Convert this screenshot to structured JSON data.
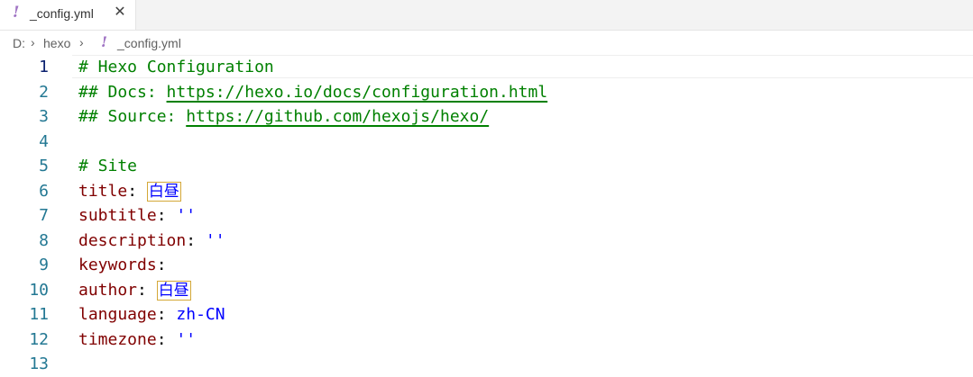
{
  "tab": {
    "icon": "!",
    "label": "_config.yml",
    "close": "✕"
  },
  "breadcrumbs": {
    "drive": "D:",
    "folder": "hexo",
    "icon": "!",
    "file": "_config.yml",
    "sep": "›"
  },
  "lines": [
    {
      "num": "1",
      "parts": [
        {
          "t": "# Hexo Configuration",
          "c": "comment"
        }
      ]
    },
    {
      "num": "2",
      "parts": [
        {
          "t": "## Docs: ",
          "c": "comment"
        },
        {
          "t": "https://hexo.io/docs/configuration.html",
          "c": "link"
        }
      ]
    },
    {
      "num": "3",
      "parts": [
        {
          "t": "## Source: ",
          "c": "comment"
        },
        {
          "t": "https://github.com/hexojs/hexo/",
          "c": "link"
        }
      ]
    },
    {
      "num": "4",
      "parts": []
    },
    {
      "num": "5",
      "parts": [
        {
          "t": "# Site",
          "c": "comment"
        }
      ]
    },
    {
      "num": "6",
      "parts": [
        {
          "t": "title",
          "c": "key"
        },
        {
          "t": ": ",
          "c": "punc"
        },
        {
          "t": "白昼",
          "c": "cjk"
        }
      ]
    },
    {
      "num": "7",
      "parts": [
        {
          "t": "subtitle",
          "c": "key"
        },
        {
          "t": ": ",
          "c": "punc"
        },
        {
          "t": "''",
          "c": "str"
        }
      ]
    },
    {
      "num": "8",
      "parts": [
        {
          "t": "description",
          "c": "key"
        },
        {
          "t": ": ",
          "c": "punc"
        },
        {
          "t": "''",
          "c": "str"
        }
      ]
    },
    {
      "num": "9",
      "parts": [
        {
          "t": "keywords",
          "c": "key"
        },
        {
          "t": ":",
          "c": "punc"
        }
      ]
    },
    {
      "num": "10",
      "parts": [
        {
          "t": "author",
          "c": "key"
        },
        {
          "t": ": ",
          "c": "punc"
        },
        {
          "t": "白昼",
          "c": "cjk"
        }
      ]
    },
    {
      "num": "11",
      "parts": [
        {
          "t": "language",
          "c": "key"
        },
        {
          "t": ": ",
          "c": "punc"
        },
        {
          "t": "zh-CN",
          "c": "str"
        }
      ]
    },
    {
      "num": "12",
      "parts": [
        {
          "t": "timezone",
          "c": "key"
        },
        {
          "t": ": ",
          "c": "punc"
        },
        {
          "t": "''",
          "c": "str"
        }
      ]
    },
    {
      "num": "13",
      "parts": []
    }
  ],
  "colors": {
    "comment": "#008000",
    "key": "#800000",
    "string": "#0000ff",
    "line_number": "#237893",
    "active_line_number": "#0b216f",
    "yaml_icon": "#a074c4"
  }
}
